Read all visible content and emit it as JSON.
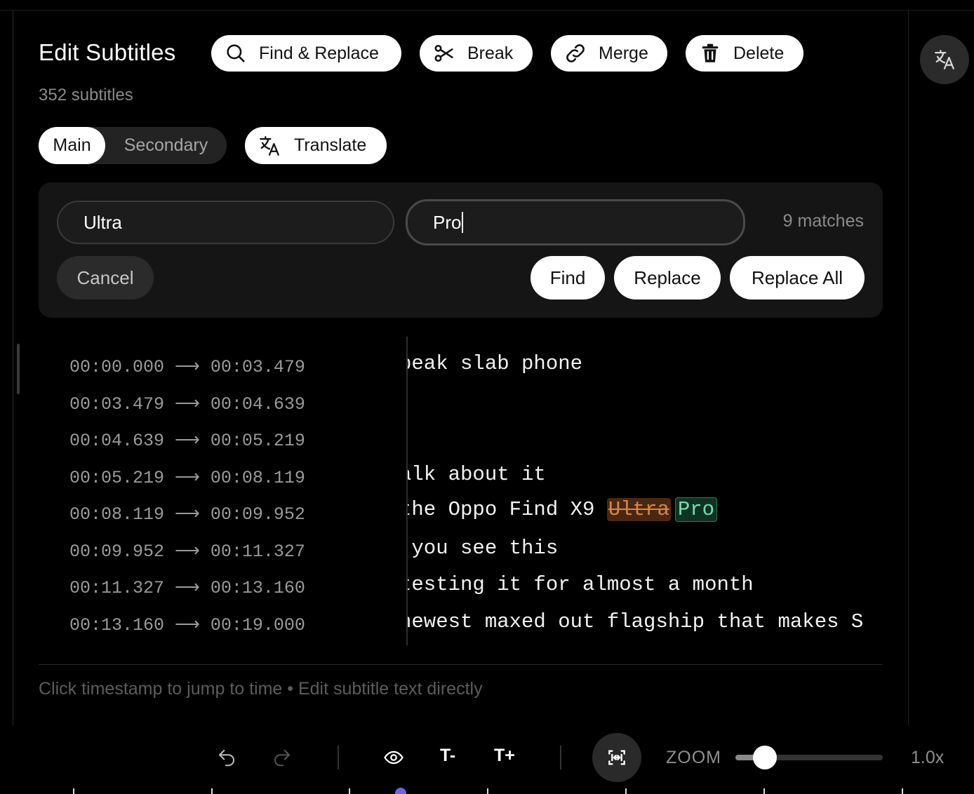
{
  "header": {
    "title": "Edit Subtitles",
    "count": "352 subtitles"
  },
  "actions": {
    "find_replace": "Find & Replace",
    "break": "Break",
    "merge": "Merge",
    "delete": "Delete"
  },
  "tracks": {
    "main": "Main",
    "secondary": "Secondary",
    "selected": "Main",
    "translate": "Translate"
  },
  "find_replace_panel": {
    "find_value": "Ultra",
    "replace_value": "Pro",
    "matches": "9 matches",
    "cancel": "Cancel",
    "find": "Find",
    "replace": "Replace",
    "replace_all": "Replace All"
  },
  "subtitles": [
    {
      "start": "00:00.000",
      "end": "00:03.479",
      "text": "peak slab phone"
    },
    {
      "start": "00:03.479",
      "end": "00:04.639",
      "text": ""
    },
    {
      "start": "00:04.639",
      "end": "00:05.219",
      "text": ""
    },
    {
      "start": "00:05.219",
      "end": "00:08.119",
      "text": "alk about it"
    },
    {
      "start": "00:08.119",
      "end": "00:09.952",
      "text_before": "the Oppo Find X9 ",
      "match_old": "Ultra",
      "match_new": "Pro"
    },
    {
      "start": "00:09.952",
      "end": "00:11.327",
      "text": " you see this"
    },
    {
      "start": "00:11.327",
      "end": "00:13.160",
      "text": "testing it for almost a month"
    },
    {
      "start": "00:13.160",
      "end": "00:19.000",
      "text": "newest maxed out flagship that makes S"
    }
  ],
  "arrow": "⟶",
  "hint": "Click timestamp to jump to time • Edit subtitle text directly",
  "toolbar": {
    "font_smaller": "T-",
    "font_larger": "T+",
    "zoom_label": "ZOOM",
    "zoom_value": "1.0x",
    "zoom_fraction": 0.2
  },
  "colors": {
    "highlight_old_bg": "#4a2810",
    "highlight_new_bg": "#0e3324",
    "playhead": "#6b63f6"
  },
  "icons": [
    "search-icon",
    "scissors-icon",
    "link-icon",
    "trash-icon",
    "translate-icon",
    "undo-icon",
    "redo-icon",
    "eye-icon",
    "fit-icon"
  ]
}
